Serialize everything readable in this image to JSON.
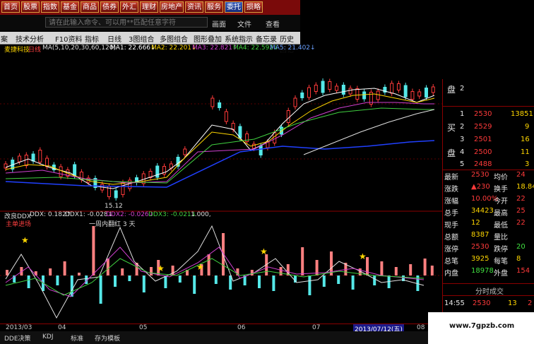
{
  "nav": {
    "items": [
      "首页",
      "股票",
      "指数",
      "基金",
      "商品",
      "债券",
      "外汇",
      "理财",
      "房地产",
      "资讯",
      "服务",
      "委托",
      "损略"
    ],
    "active": "委托"
  },
  "command": {
    "placeholder": "请在此输入命令、可以用**匹配任意字符",
    "menu_view": "画面",
    "menu_file": "文件",
    "menu_check": "查看"
  },
  "toolbar": {
    "items": [
      "案",
      "技术分析",
      "F10资料",
      "指标",
      "日线",
      "3图组合",
      "多图组合",
      "图形叠加",
      "系统指示",
      "备忘录",
      "历史回忆"
    ]
  },
  "stock": {
    "name": "麦捷科技",
    "period": "日线",
    "ma_params": "MA(5,10,20,30,60,120)",
    "ma1": "MA1: 22.666↓",
    "ma2": "MA2: 22.201↓",
    "ma3": "MA3: 22.821↑",
    "ma4": "MA4: 22.592↓",
    "ma5": "MA5: 21.402↓",
    "low_label": "15.12"
  },
  "indicator": {
    "name": "改良DDX",
    "ddx": "DDX: 0.182↑",
    "ddx1": "DDX1: -0.028↓",
    "ddx2": "DDX2: -0.026↓",
    "ddx3": "DDX3: -0.021↓",
    "extra": "1.000,",
    "note1": "主单进场",
    "note2": "一周内翻红 3 天"
  },
  "dates": [
    "2013/03",
    "04",
    "05",
    "06",
    "07",
    "08"
  ],
  "highlight_date": "2013/07/12(五)",
  "bottom_tabs": [
    "DDE决策",
    "KDJ",
    "标准",
    "存为模板"
  ],
  "orderbook": {
    "sell": [
      {
        "label": "盘",
        "level": "2",
        "price": "",
        "vol": ""
      }
    ],
    "buy": [
      {
        "label": "",
        "level": "1",
        "price": "2530",
        "vol": "13851"
      },
      {
        "label": "买",
        "level": "2",
        "price": "2529",
        "vol": "9"
      },
      {
        "label": "",
        "level": "3",
        "price": "2501",
        "vol": "16"
      },
      {
        "label": "盘",
        "level": "4",
        "price": "2500",
        "vol": "11"
      },
      {
        "label": "",
        "level": "5",
        "price": "2488",
        "vol": "3"
      }
    ]
  },
  "stats": [
    {
      "l1": "最新",
      "v1": "2530",
      "c1": "red",
      "l2": "均价",
      "v2": "24",
      "c2": "red"
    },
    {
      "l1": "涨跌",
      "v1": "▲230",
      "c1": "red",
      "l2": "换手",
      "v2": "18.84",
      "c2": "yellow"
    },
    {
      "l1": "涨幅",
      "v1": "10.00%",
      "c1": "red",
      "l2": "今开",
      "v2": "22",
      "c2": "red"
    },
    {
      "l1": "总手",
      "v1": "34423",
      "c1": "yellow",
      "l2": "最高",
      "v2": "25",
      "c2": "red"
    },
    {
      "l1": "现手",
      "v1": "12",
      "c1": "yellow",
      "l2": "最低",
      "v2": "22",
      "c2": "red"
    },
    {
      "l1": "总额",
      "v1": "8387",
      "c1": "yellow",
      "l2": "量比",
      "v2": "",
      "c2": "white"
    },
    {
      "l1": "涨停",
      "v1": "2530",
      "c1": "red",
      "l2": "跌停",
      "v2": "20",
      "c2": "green"
    },
    {
      "l1": "总笔",
      "v1": "3925",
      "c1": "yellow",
      "l2": "每笔",
      "v2": "8",
      "c2": "yellow"
    },
    {
      "l1": "内盘",
      "v1": "18978",
      "c1": "green",
      "l2": "外盘",
      "v2": "154",
      "c2": "red"
    }
  ],
  "tick_header": "分时成交",
  "tick": {
    "time": "14:55",
    "price": "2530",
    "vol": "13",
    "dir": "2"
  },
  "watermark": "www.7gpzb.com",
  "colors": {
    "up": "#ff3a3a",
    "down": "#55e8e8",
    "ma1": "#ffffff",
    "ma2": "#ffd700",
    "ma3": "#d040d0",
    "ma4": "#40d040",
    "ma5": "#2040ff"
  }
}
